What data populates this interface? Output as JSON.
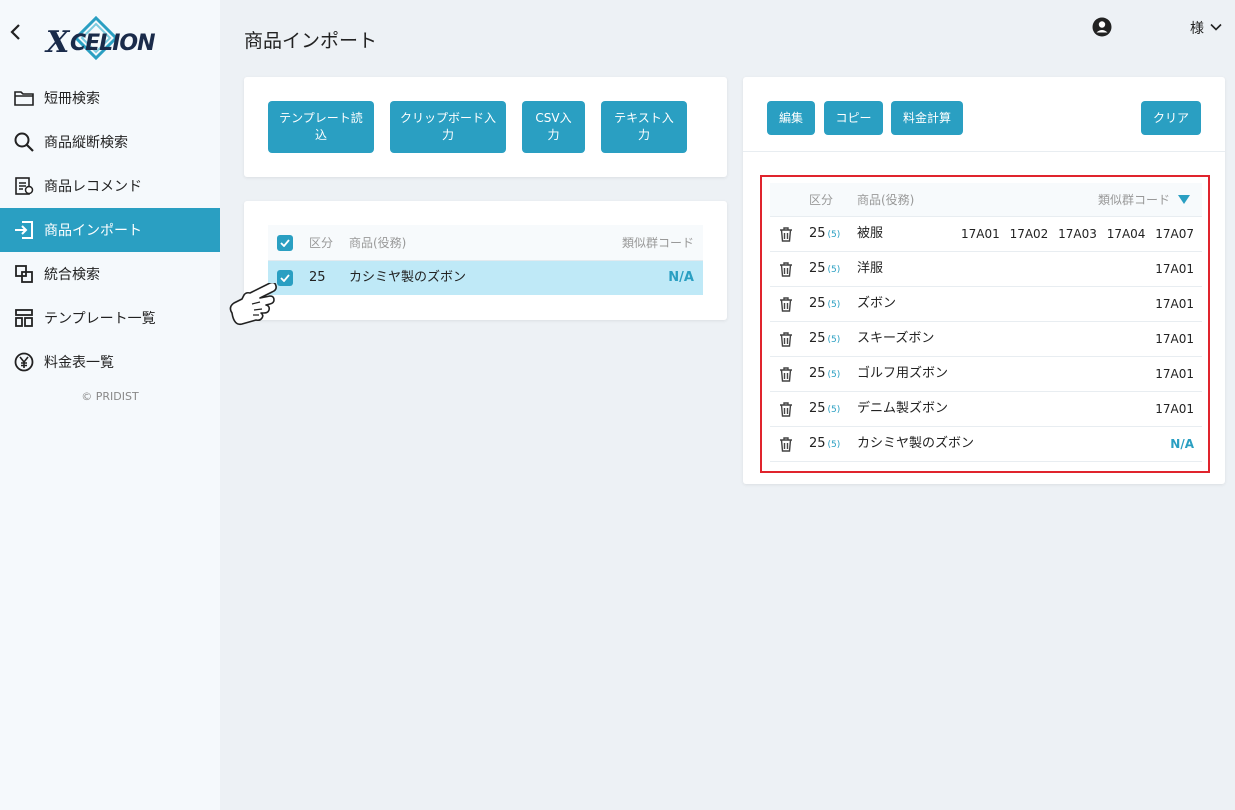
{
  "sidebar": {
    "logo_text": "XCELION",
    "items": [
      {
        "label": "短冊検索",
        "icon": "folder-icon"
      },
      {
        "label": "商品縦断検索",
        "icon": "search-icon"
      },
      {
        "label": "商品レコメンド",
        "icon": "recommend-icon"
      },
      {
        "label": "商品インポート",
        "icon": "import-icon",
        "active": true
      },
      {
        "label": "統合検索",
        "icon": "merge-icon"
      },
      {
        "label": "テンプレート一覧",
        "icon": "template-icon"
      },
      {
        "label": "料金表一覧",
        "icon": "yen-icon"
      }
    ],
    "copyright": "© PRIDIST"
  },
  "header": {
    "title": "商品インポート",
    "user_suffix": "様"
  },
  "import_buttons": {
    "template": "テンプレート読込",
    "clipboard": "クリップボード入力",
    "csv": "CSV入力",
    "text": "テキスト入力"
  },
  "left_table": {
    "headers": {
      "class": "区分",
      "product": "商品(役務)",
      "code": "類似群コード"
    },
    "rows": [
      {
        "class": "25",
        "product": "カシミヤ製のズボン",
        "code": "N/A"
      }
    ]
  },
  "right_toolbar": {
    "edit": "編集",
    "copy": "コピー",
    "calc": "料金計算",
    "clear": "クリア"
  },
  "right_table": {
    "headers": {
      "class": "区分",
      "product": "商品(役務)",
      "code": "類似群コード"
    },
    "rows": [
      {
        "class": "25",
        "sub": "(5)",
        "product": "被服",
        "codes": "17A01 17A02 17A03 17A04 17A07"
      },
      {
        "class": "25",
        "sub": "(5)",
        "product": "洋服",
        "codes": "17A01"
      },
      {
        "class": "25",
        "sub": "(5)",
        "product": "ズボン",
        "codes": "17A01"
      },
      {
        "class": "25",
        "sub": "(5)",
        "product": "スキーズボン",
        "codes": "17A01"
      },
      {
        "class": "25",
        "sub": "(5)",
        "product": "ゴルフ用ズボン",
        "codes": "17A01"
      },
      {
        "class": "25",
        "sub": "(5)",
        "product": "デニム製ズボン",
        "codes": "17A01"
      },
      {
        "class": "25",
        "sub": "(5)",
        "product": "カシミヤ製のズボン",
        "codes": "N/A"
      }
    ]
  },
  "colors": {
    "accent": "#2a9fc2",
    "highlight_border": "#e0242d",
    "selected_row": "#bfe9f7"
  }
}
